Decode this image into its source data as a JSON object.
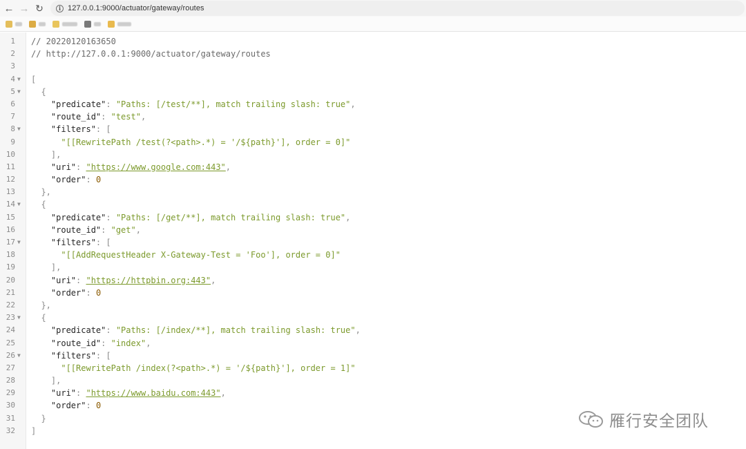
{
  "browser": {
    "back_icon": "arrow-left-icon",
    "forward_icon": "arrow-right-icon",
    "reload_icon": "reload-icon",
    "url": "127.0.0.1:9000/actuator/gateway/routes"
  },
  "editor": {
    "lines": [
      {
        "n": "1",
        "fold": false,
        "tokens": [
          {
            "t": "// 20220120163650",
            "c": "c"
          }
        ]
      },
      {
        "n": "2",
        "fold": false,
        "tokens": [
          {
            "t": "// http://127.0.0.1:9000/actuator/gateway/routes",
            "c": "c"
          }
        ]
      },
      {
        "n": "3",
        "fold": false,
        "tokens": []
      },
      {
        "n": "4",
        "fold": true,
        "tokens": [
          {
            "t": "[",
            "c": "p"
          }
        ]
      },
      {
        "n": "5",
        "fold": true,
        "tokens": [
          {
            "t": "  {",
            "c": "p"
          }
        ]
      },
      {
        "n": "6",
        "fold": false,
        "tokens": [
          {
            "t": "    \"predicate\"",
            "c": "k"
          },
          {
            "t": ": ",
            "c": "p"
          },
          {
            "t": "\"Paths: [/test/**], match trailing slash: true\"",
            "c": "s"
          },
          {
            "t": ",",
            "c": "p"
          }
        ]
      },
      {
        "n": "7",
        "fold": false,
        "tokens": [
          {
            "t": "    \"route_id\"",
            "c": "k"
          },
          {
            "t": ": ",
            "c": "p"
          },
          {
            "t": "\"test\"",
            "c": "s"
          },
          {
            "t": ",",
            "c": "p"
          }
        ]
      },
      {
        "n": "8",
        "fold": true,
        "tokens": [
          {
            "t": "    \"filters\"",
            "c": "k"
          },
          {
            "t": ": [",
            "c": "p"
          }
        ]
      },
      {
        "n": "9",
        "fold": false,
        "tokens": [
          {
            "t": "      \"[[RewritePath /test(?<path>.*) = '/${path}'], order = 0]\"",
            "c": "s"
          }
        ]
      },
      {
        "n": "10",
        "fold": false,
        "tokens": [
          {
            "t": "    ],",
            "c": "p"
          }
        ]
      },
      {
        "n": "11",
        "fold": false,
        "tokens": [
          {
            "t": "    \"uri\"",
            "c": "k"
          },
          {
            "t": ": ",
            "c": "p"
          },
          {
            "t": "\"https://www.google.com:443\"",
            "c": "u"
          },
          {
            "t": ",",
            "c": "p"
          }
        ]
      },
      {
        "n": "12",
        "fold": false,
        "tokens": [
          {
            "t": "    \"order\"",
            "c": "k"
          },
          {
            "t": ": ",
            "c": "p"
          },
          {
            "t": "0",
            "c": "n"
          }
        ]
      },
      {
        "n": "13",
        "fold": false,
        "tokens": [
          {
            "t": "  },",
            "c": "p"
          }
        ]
      },
      {
        "n": "14",
        "fold": true,
        "tokens": [
          {
            "t": "  {",
            "c": "p"
          }
        ]
      },
      {
        "n": "15",
        "fold": false,
        "tokens": [
          {
            "t": "    \"predicate\"",
            "c": "k"
          },
          {
            "t": ": ",
            "c": "p"
          },
          {
            "t": "\"Paths: [/get/**], match trailing slash: true\"",
            "c": "s"
          },
          {
            "t": ",",
            "c": "p"
          }
        ]
      },
      {
        "n": "16",
        "fold": false,
        "tokens": [
          {
            "t": "    \"route_id\"",
            "c": "k"
          },
          {
            "t": ": ",
            "c": "p"
          },
          {
            "t": "\"get\"",
            "c": "s"
          },
          {
            "t": ",",
            "c": "p"
          }
        ]
      },
      {
        "n": "17",
        "fold": true,
        "tokens": [
          {
            "t": "    \"filters\"",
            "c": "k"
          },
          {
            "t": ": [",
            "c": "p"
          }
        ]
      },
      {
        "n": "18",
        "fold": false,
        "tokens": [
          {
            "t": "      \"[[AddRequestHeader X-Gateway-Test = 'Foo'], order = 0]\"",
            "c": "s"
          }
        ]
      },
      {
        "n": "19",
        "fold": false,
        "tokens": [
          {
            "t": "    ],",
            "c": "p"
          }
        ]
      },
      {
        "n": "20",
        "fold": false,
        "tokens": [
          {
            "t": "    \"uri\"",
            "c": "k"
          },
          {
            "t": ": ",
            "c": "p"
          },
          {
            "t": "\"https://httpbin.org:443\"",
            "c": "u"
          },
          {
            "t": ",",
            "c": "p"
          }
        ]
      },
      {
        "n": "21",
        "fold": false,
        "tokens": [
          {
            "t": "    \"order\"",
            "c": "k"
          },
          {
            "t": ": ",
            "c": "p"
          },
          {
            "t": "0",
            "c": "n"
          }
        ]
      },
      {
        "n": "22",
        "fold": false,
        "tokens": [
          {
            "t": "  },",
            "c": "p"
          }
        ]
      },
      {
        "n": "23",
        "fold": true,
        "tokens": [
          {
            "t": "  {",
            "c": "p"
          }
        ]
      },
      {
        "n": "24",
        "fold": false,
        "tokens": [
          {
            "t": "    \"predicate\"",
            "c": "k"
          },
          {
            "t": ": ",
            "c": "p"
          },
          {
            "t": "\"Paths: [/index/**], match trailing slash: true\"",
            "c": "s"
          },
          {
            "t": ",",
            "c": "p"
          }
        ]
      },
      {
        "n": "25",
        "fold": false,
        "tokens": [
          {
            "t": "    \"route_id\"",
            "c": "k"
          },
          {
            "t": ": ",
            "c": "p"
          },
          {
            "t": "\"index\"",
            "c": "s"
          },
          {
            "t": ",",
            "c": "p"
          }
        ]
      },
      {
        "n": "26",
        "fold": true,
        "tokens": [
          {
            "t": "    \"filters\"",
            "c": "k"
          },
          {
            "t": ": [",
            "c": "p"
          }
        ]
      },
      {
        "n": "27",
        "fold": false,
        "tokens": [
          {
            "t": "      \"[[RewritePath /index(?<path>.*) = '/${path}'], order = 1]\"",
            "c": "s"
          }
        ]
      },
      {
        "n": "28",
        "fold": false,
        "tokens": [
          {
            "t": "    ],",
            "c": "p"
          }
        ]
      },
      {
        "n": "29",
        "fold": false,
        "tokens": [
          {
            "t": "    \"uri\"",
            "c": "k"
          },
          {
            "t": ": ",
            "c": "p"
          },
          {
            "t": "\"https://www.baidu.com:443\"",
            "c": "u"
          },
          {
            "t": ",",
            "c": "p"
          }
        ]
      },
      {
        "n": "30",
        "fold": false,
        "tokens": [
          {
            "t": "    \"order\"",
            "c": "k"
          },
          {
            "t": ": ",
            "c": "p"
          },
          {
            "t": "0",
            "c": "n"
          }
        ]
      },
      {
        "n": "31",
        "fold": false,
        "tokens": [
          {
            "t": "  }",
            "c": "p"
          }
        ]
      },
      {
        "n": "32",
        "fold": false,
        "tokens": [
          {
            "t": "]",
            "c": "p"
          }
        ]
      }
    ]
  },
  "watermark": {
    "text": "雁行安全团队",
    "icon": "wechat-icon"
  },
  "colors": {
    "string": "#7c9a2c",
    "number": "#8a5a00",
    "key": "#262626",
    "comment": "#6a6a6a"
  }
}
